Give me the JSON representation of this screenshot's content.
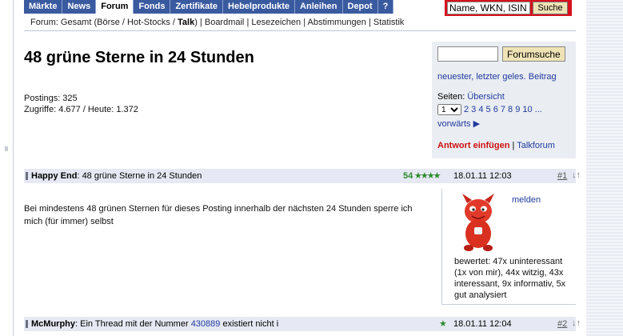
{
  "nav": {
    "items": [
      "Märkte",
      "News",
      "Forum",
      "Fonds",
      "Zertifikate",
      "Hebelprodukte",
      "Anleihen",
      "Depot",
      "?"
    ],
    "active": "Forum",
    "search_value": "Name, WKN, ISIN",
    "search_button": "Suche"
  },
  "breadcrumb": {
    "prefix": "Forum: Gesamt (Börse / Hot-Stocks / ",
    "talk": "Talk",
    "suffix": ")",
    "links": [
      "Boardmail",
      "Lesezeichen",
      "Abstimmungen",
      "Statistik"
    ]
  },
  "thread": {
    "title": "48 grüne Sterne in 24 Stunden",
    "postings": "Postings: 325",
    "views": "Zugriffe: 4.677 / Heute: 1.372"
  },
  "infobox": {
    "search_button": "Forumsuche",
    "newest_link": "neuester, letzter geles. Beitrag",
    "pages_label": "Seiten: ",
    "overview_link": "Übersicht",
    "page_select": "1",
    "page_numbers": "2 3 4 5 6 7 8 9 10 ...",
    "forward": "vorwärts ▶",
    "reply": "Antwort einfügen",
    "separator": " | ",
    "talkforum": "Talkforum"
  },
  "posts": [
    {
      "author": "Happy End",
      "subject": ": 48 grüne Sterne in 24 Stunden",
      "score": "54",
      "stars": "★★★★",
      "date": "18.01.11 12:03",
      "num": "#1",
      "arrows": "↓↑",
      "body": "Bei mindestens 48 grünen Sternen für dieses Posting innerhalb der nächsten 24 Stunden sperre ich mich (für immer) selbst",
      "melden": "melden",
      "rating": "bewertet: 47x uninteressant (1x von mir), 44x witzig, 43x interessant, 9x informativ, 5x gut analysiert"
    },
    {
      "author": "McMurphy",
      "subject_pre": ": Ein Thread mit der Nummer ",
      "subject_link": "430889",
      "subject_post": " existiert nicht i",
      "stars": "★",
      "date": "18.01.11 12:04",
      "num": "#2",
      "arrows": "↓↑"
    }
  ],
  "colors": {
    "nav_bg": "#3a5aa0",
    "search_frame": "#d8101c",
    "link": "#1f3a9e",
    "star_green": "#2d8a2d",
    "reply_red": "#cc1111"
  }
}
